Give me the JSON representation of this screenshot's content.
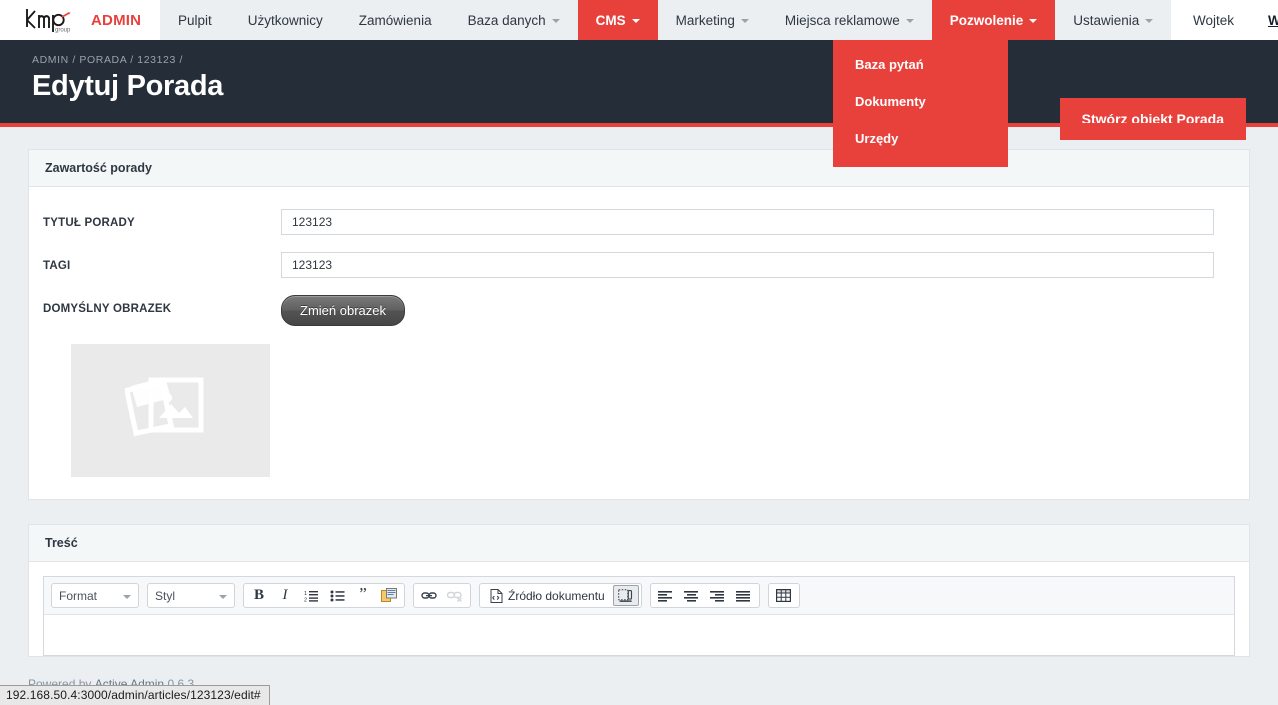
{
  "brand": {
    "logo_text": "kmp",
    "logo_sub": "group",
    "admin_label": "ADMIN"
  },
  "nav": {
    "items": [
      {
        "label": "Pulpit",
        "has_caret": false,
        "active": false
      },
      {
        "label": "Użytkownicy",
        "has_caret": false,
        "active": false
      },
      {
        "label": "Zamówienia",
        "has_caret": false,
        "active": false
      },
      {
        "label": "Baza danych",
        "has_caret": true,
        "active": false
      },
      {
        "label": "CMS",
        "has_caret": true,
        "active": true
      },
      {
        "label": "Marketing",
        "has_caret": true,
        "active": false
      },
      {
        "label": "Miejsca reklamowe",
        "has_caret": true,
        "active": false
      },
      {
        "label": "Pozwolenie",
        "has_caret": true,
        "active": true
      },
      {
        "label": "Ustawienia",
        "has_caret": true,
        "active": false
      }
    ],
    "user": "Wojtek",
    "logout": "Wyloguj"
  },
  "dropdown": {
    "parent": "Pozwolenie",
    "items": [
      {
        "label": "Baza pytań"
      },
      {
        "label": "Dokumenty"
      },
      {
        "label": "Urzędy"
      }
    ]
  },
  "header": {
    "breadcrumb": "ADMIN / PORADA / 123123 /",
    "title": "Edytuj Porada",
    "action_label": "Stwórz obiekt Porada"
  },
  "panels": {
    "content_panel": {
      "title": "Zawartość porady",
      "fields": [
        {
          "label": "Tytuł porady",
          "value": "123123"
        },
        {
          "label": "Tagi",
          "value": "123123"
        }
      ],
      "image_field": {
        "label": "Domyślny obrazek",
        "button_label": "Zmień obrazek",
        "placeholder_icon": "image-placeholder-icon"
      }
    },
    "body_panel": {
      "title": "Treść",
      "toolbar": {
        "format_select": "Format",
        "style_select": "Styl",
        "buttons": [
          {
            "name": "bold",
            "glyph": "B"
          },
          {
            "name": "italic",
            "glyph": "I"
          },
          {
            "name": "numbered-list",
            "glyph": ""
          },
          {
            "name": "bulleted-list",
            "glyph": ""
          },
          {
            "name": "blockquote",
            "glyph": "”"
          },
          {
            "name": "paste-from-word",
            "glyph": ""
          },
          {
            "name": "link",
            "glyph": ""
          },
          {
            "name": "unlink",
            "glyph": ""
          }
        ],
        "source_button": "Źródło dokumentu",
        "align_buttons": [
          "align-left",
          "align-center",
          "align-right",
          "align-justify"
        ],
        "table_button": "table"
      }
    }
  },
  "footer": {
    "powered_prefix": "Powered by",
    "link": "Active Admin",
    "version": "0.6.3"
  },
  "statusbar": {
    "url": "192.168.50.4:3000/admin/articles/123123/edit#"
  },
  "colors": {
    "accent": "#E8413C",
    "header_bg": "#242D38",
    "page_bg": "#ECEFF1"
  }
}
